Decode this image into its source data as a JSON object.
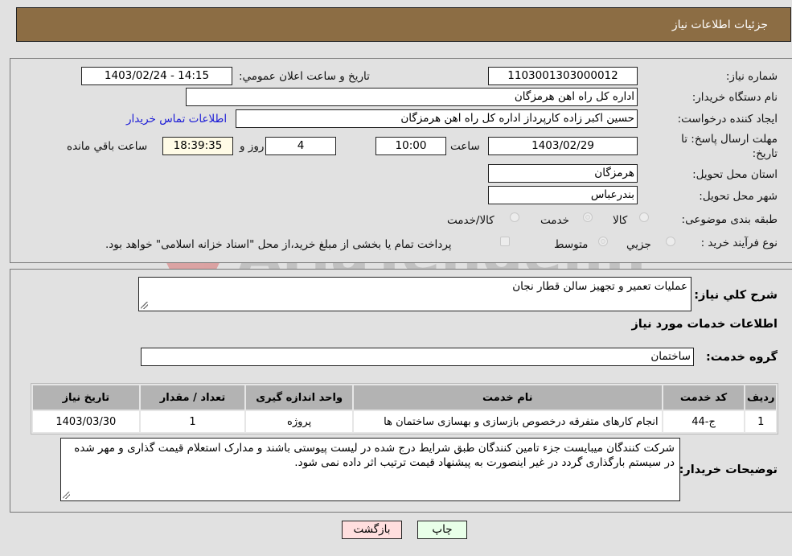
{
  "header": {
    "title": "جزئیات اطلاعات نیاز"
  },
  "form": {
    "need_number": {
      "label": "شماره نیاز:",
      "value": "1103001303000012"
    },
    "announce_datetime": {
      "label": "تاریخ و ساعت اعلان عمومي:",
      "value": "1403/02/24 - 14:15"
    },
    "buyer_org": {
      "label": "نام دستگاه خريدار:",
      "value": "اداره کل راه اهن هرمزگان"
    },
    "requester": {
      "label": "ايجاد کننده درخواست:",
      "value": "حسين اکبر زاده  کارپرداز اداره کل راه اهن هرمزگان",
      "contact_link": "اطلاعات تماس خريدار"
    },
    "deadline": {
      "label": "مهلت ارسال پاسخ: تا تاریخ:",
      "date": "1403/02/29",
      "time_label": "ساعت",
      "time": "10:00",
      "days": "4",
      "days_label": "روز و",
      "remaining": "18:39:35",
      "remaining_label": "ساعت باقي مانده"
    },
    "province": {
      "label": "استان محل تحویل:",
      "value": "هرمزگان"
    },
    "city": {
      "label": "شهر محل تحویل:",
      "value": "بندرعباس"
    },
    "category": {
      "label": "طبقه بندی موضوعی:",
      "options": [
        {
          "label": "کالا",
          "selected": false
        },
        {
          "label": "خدمت",
          "selected": true
        },
        {
          "label": "کالا/خدمت",
          "selected": false
        }
      ]
    },
    "purchase_type": {
      "label": "نوع فرآیند خرید :",
      "options": [
        {
          "label": "جزيي",
          "selected": false
        },
        {
          "label": "متوسط",
          "selected": true
        }
      ],
      "treasury_note": "پرداخت تمام يا بخشی از مبلغ خريد،از محل \"اسناد خزانه اسلامی\" خواهد بود.",
      "treasury_checked": false
    }
  },
  "details": {
    "summary_label": "شرح کلي نياز:",
    "summary_value": "عملیات تعمیر و تجهیز سالن قطار نجان",
    "services_heading": "اطلاعات خدمات مورد نياز",
    "service_group_label": "گروه خدمت:",
    "service_group_value": "ساختمان",
    "table": {
      "columns": [
        "رديف",
        "کد خدمت",
        "نام خدمت",
        "واحد اندازه گيری",
        "تعداد / مقدار",
        "تاريخ نياز"
      ],
      "rows": [
        [
          "1",
          "ج-44",
          "انجام کارهای متفرقه درخصوص بازسازی و بهسازی ساختمان ها",
          "پروژه",
          "1",
          "1403/03/30"
        ]
      ]
    },
    "buyer_notes_label": "توضيحات خريدار:",
    "buyer_notes_value": "شرکت کنندگان میبایست جزء تامین کنندگان طبق شرایط درج شده در لیست پیوستی باشند و مدارک استعلام قیمت گذاری و مهر شده در سیستم بارگذاری گردد در غیر اینصورت به پیشنهاد قیمت ترتیب اثر داده نمی شود."
  },
  "buttons": {
    "print": "چاپ",
    "back": "بازگشت"
  },
  "watermark": {
    "text": "AriaTender.neT"
  }
}
